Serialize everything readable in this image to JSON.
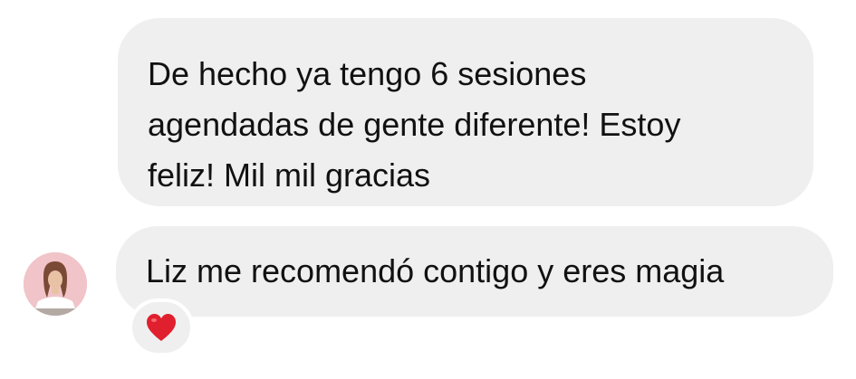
{
  "conversation": {
    "messages": [
      {
        "lines": [
          "De hecho ya tengo 6 sesiones",
          "agendadas de gente diferente! Estoy",
          "feliz! Mil mil gracias"
        ]
      },
      {
        "text": "Liz me recomendó contigo y eres magia",
        "reaction_icon": "heart-icon"
      }
    ]
  },
  "colors": {
    "bubble": "#efefef",
    "text": "#111111",
    "heart": "#e0202e",
    "avatar_bg": "#f0c4c8"
  }
}
